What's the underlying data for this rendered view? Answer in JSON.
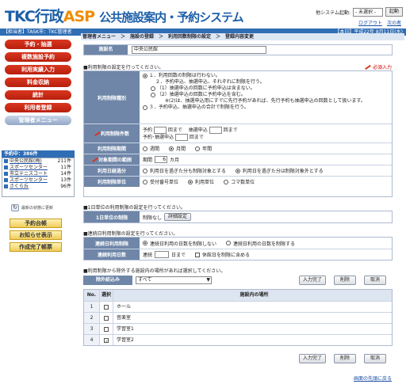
{
  "header": {
    "logo_tkc": "TKC行政",
    "logo_asp": "ASP",
    "logo_sub": "公共施設案内・予約システム",
    "system_label": "他システム起動:",
    "system_select": "- 未選択 -",
    "system_button": "起動",
    "logout": "ログアウト",
    "next_time": "次の者"
  },
  "bluebar": {
    "left": "【担当者】TASK市：TKC管理者",
    "right": "【本日】平成22年 8月11日(水)"
  },
  "sidebar": {
    "menu": [
      {
        "label": "予約・抽選"
      },
      {
        "label": "複数施設予約"
      },
      {
        "label": "利用実績入力"
      },
      {
        "label": "料金収納"
      },
      {
        "label": "統計"
      },
      {
        "label": "利用者登録"
      },
      {
        "label": "管理者メニュー"
      }
    ],
    "yoyaku_title": "予約中：386件",
    "yoyaku_list": [
      {
        "name": "中央公民館(梅)",
        "count": "211件"
      },
      {
        "name": "スポーツセンター",
        "count": "11件"
      },
      {
        "name": "市立テニスコート",
        "count": "14件"
      },
      {
        "name": "スポーツセンター",
        "count": "13件"
      },
      {
        "name": "さくら丘",
        "count": "96件"
      }
    ],
    "refresh": "最新の状態に更新",
    "buttons": [
      {
        "label": "予約台帳"
      },
      {
        "label": "お知らせ表示"
      },
      {
        "label": "作成完了帳票"
      }
    ]
  },
  "breadcrumb": "管理者メニュー　＞　施設の登録　＞　利用回数制限の設定　＞　登録内容変更",
  "facility": {
    "label": "施設名",
    "value": "中央公民館"
  },
  "section1": {
    "title": "■利用制限の設定を行ってください。",
    "required": "必須入力"
  },
  "restrict_type": {
    "label": "利用制限種別",
    "options": [
      "１．利用回数の制限は行わない。",
      "２．予約申込、抽選申込、それぞれに制限を行う。",
      "（1）抽選申込の回数に予約申込は含まない。",
      "（2）抽選申込の回数に予約申込を含む。",
      "※(2)は、抽選申込用にすでに先行予約があれば、先行予約も抽選申込の回数として扱います。",
      "３．予約申込、抽選申込の合計で制限を行う。"
    ]
  },
  "limit_count": {
    "label": "利用制限件数",
    "yoyaku": "予約",
    "kai": "回まで",
    "chusen": "抽選申込",
    "sum": "予約･抽選申込"
  },
  "limit_period": {
    "label": "利用制限期間",
    "options": [
      "週間",
      "月間",
      "年間"
    ]
  },
  "target_range": {
    "label": "対象期間の範囲",
    "prefix": "期間",
    "value": "6",
    "unit": "カ月"
  },
  "use_date": {
    "label": "利用日経過分",
    "options": [
      "利用日を過ぎた分も制限対象とする",
      "利用日を過ぎた分は制限対象外とする"
    ]
  },
  "limit_unit": {
    "label": "利用制限単位",
    "options": [
      "受付番号単位",
      "利用単位",
      "コマ数単位"
    ]
  },
  "section2": {
    "title": "■1日単位の利用制限の設定を行ってください。"
  },
  "day_limit": {
    "label": "1日単位の制限",
    "value": "制限なし",
    "button": "詳細設定"
  },
  "section3": {
    "title": "■連続日利用制限の設定を行ってください。"
  },
  "consec_limit": {
    "label": "連続日利用制限",
    "options": [
      "連続日利用の日数を制限しない",
      "連続日利用の日数を制限する"
    ]
  },
  "consec_days": {
    "label": "連続利用日数",
    "prefix": "連続",
    "unit": "日まで",
    "holiday": "休館日を制限に含める"
  },
  "section4": {
    "title": "■利用制限から除外する施設内の場所があれば選択してください。"
  },
  "exclude": {
    "label": "除外絞込み",
    "select": "すべて",
    "buttons": [
      "入力完了",
      "削除",
      "取消"
    ]
  },
  "table": {
    "headers": [
      "No.",
      "選択",
      "施設内の場所"
    ],
    "rows": [
      {
        "no": "1",
        "name": "ホール",
        "checked": false
      },
      {
        "no": "2",
        "name": "音楽室",
        "checked": false
      },
      {
        "no": "3",
        "name": "学習室1",
        "checked": false
      },
      {
        "no": "4",
        "name": "学習室2",
        "checked": true
      }
    ]
  },
  "bottom_buttons": [
    "入力完了",
    "削除",
    "取消"
  ],
  "footer_link": "画面の先頭に戻る"
}
